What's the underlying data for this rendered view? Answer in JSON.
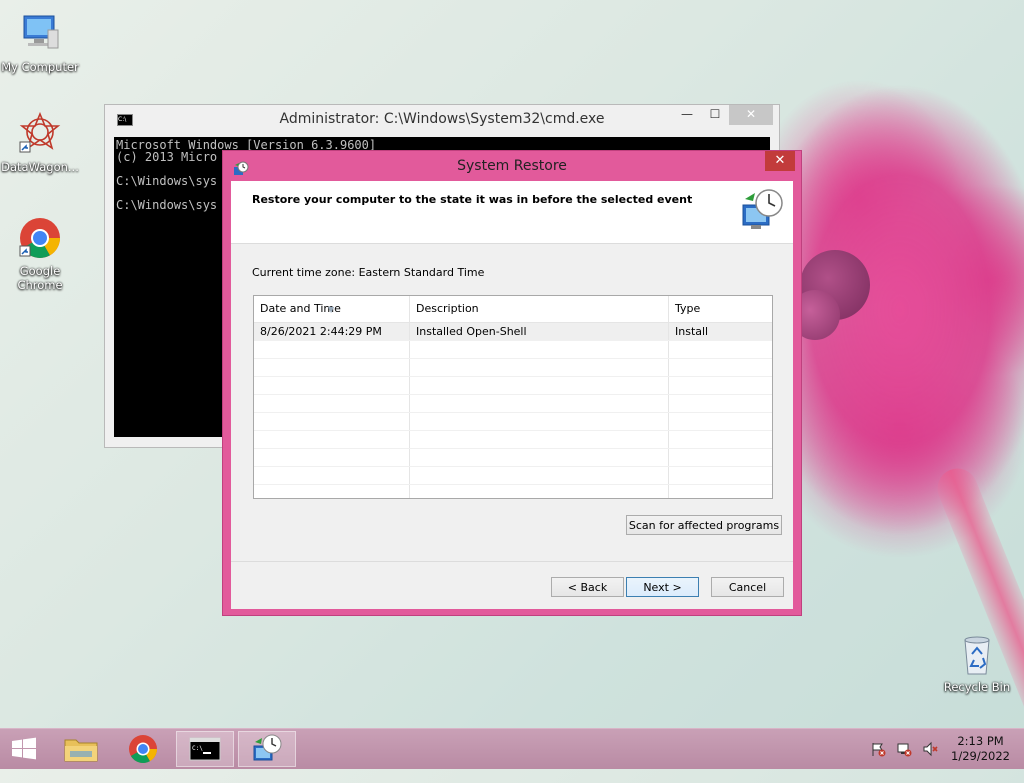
{
  "desktop": {
    "icons": [
      {
        "label": "My Computer"
      },
      {
        "label": "DataWagon..."
      },
      {
        "label": "Google Chrome"
      },
      {
        "label": "Recycle Bin"
      }
    ]
  },
  "cmd_window": {
    "title": "Administrator: C:\\Windows\\System32\\cmd.exe",
    "lines": [
      "Microsoft Windows [Version 6.3.9600]",
      "(c) 2013 Micro",
      "",
      "C:\\Windows\\sys",
      "",
      "C:\\Windows\\sys"
    ],
    "minimize": "—",
    "maximize": "☐",
    "close": "✕"
  },
  "system_restore": {
    "title": "System Restore",
    "close": "✕",
    "heading": "Restore your computer to the state it was in before the selected event",
    "timezone": "Current time zone: Eastern Standard Time",
    "columns": [
      "Date and Time",
      "Description",
      "Type"
    ],
    "rows": [
      {
        "date": "8/26/2021 2:44:29 PM",
        "description": "Installed Open-Shell",
        "type": "Install"
      }
    ],
    "scan_button": "Scan for affected programs",
    "back_button": "< Back",
    "next_button": "Next >",
    "cancel_button": "Cancel"
  },
  "taskbar": {
    "time": "2:13 PM",
    "date": "1/29/2022"
  },
  "colors": {
    "dialog_frame": "#e25a9b",
    "taskbar": "#c9a0b6",
    "primary_button_border": "#3c7fb1"
  }
}
